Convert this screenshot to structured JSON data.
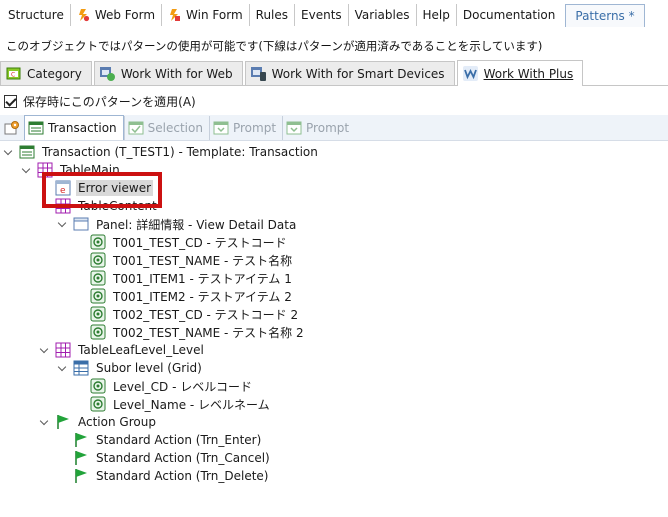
{
  "top_tabs": [
    {
      "label": "Structure",
      "icon": null
    },
    {
      "label": "Web Form",
      "icon": "web-form-icon"
    },
    {
      "label": "Win Form",
      "icon": "win-form-icon"
    },
    {
      "label": "Rules",
      "icon": null
    },
    {
      "label": "Events",
      "icon": null
    },
    {
      "label": "Variables",
      "icon": null
    },
    {
      "label": "Help",
      "icon": null
    },
    {
      "label": "Documentation",
      "icon": null
    },
    {
      "label": "Patterns *",
      "icon": null,
      "active": true
    }
  ],
  "description": "このオブジェクトではパターンの使用が可能です(下線はパターンが適用済みであることを示しています)",
  "pattern_tabs": [
    {
      "label": "Category",
      "icon": "category-icon"
    },
    {
      "label": "Work With for Web",
      "icon": "work-with-web-icon"
    },
    {
      "label": "Work With for Smart Devices",
      "icon": "work-with-smart-devices-icon"
    },
    {
      "label": "Work With Plus",
      "icon": "work-with-plus-icon",
      "active": true
    }
  ],
  "apply_on_save": {
    "label": "保存時にこのパターンを適用(A)",
    "checked": true
  },
  "inner_toolbar": [
    {
      "label": "Transaction",
      "state": "active"
    },
    {
      "label": "Selection",
      "state": "disabled"
    },
    {
      "label": "Prompt",
      "state": "disabled"
    },
    {
      "label": "Prompt",
      "state": "disabled"
    }
  ],
  "tree": {
    "root": "Transaction (T_TEST1) - Template: Transaction",
    "table_main": "TableMain",
    "error_viewer": "Error viewer",
    "table_content": "TableContent",
    "panel": "Panel: 詳細情報 - View Detail Data",
    "attributes": [
      "T001_TEST_CD - テストコード",
      "T001_TEST_NAME - テスト名称",
      "T001_ITEM1 - テストアイテム 1",
      "T001_ITEM2 - テストアイテム 2",
      "T002_TEST_CD - テストコード 2",
      "T002_TEST_NAME - テスト名称 2"
    ],
    "table_leaf": "TableLeafLevel_Level",
    "subor_level": "Subor level (Grid)",
    "level_attributes": [
      "Level_CD - レベルコード",
      "Level_Name - レベルネーム"
    ],
    "action_group": "Action Group",
    "actions": [
      "Standard Action (Trn_Enter)",
      "Standard Action (Trn_Cancel)",
      "Standard Action (Trn_Delete)"
    ]
  },
  "colors": {
    "highlight_border": "#cc1111",
    "active_tab_text": "#3a6ea8",
    "toolbar_bg": "#eef3f9",
    "selected_node_bg": "#d9d9d9"
  }
}
